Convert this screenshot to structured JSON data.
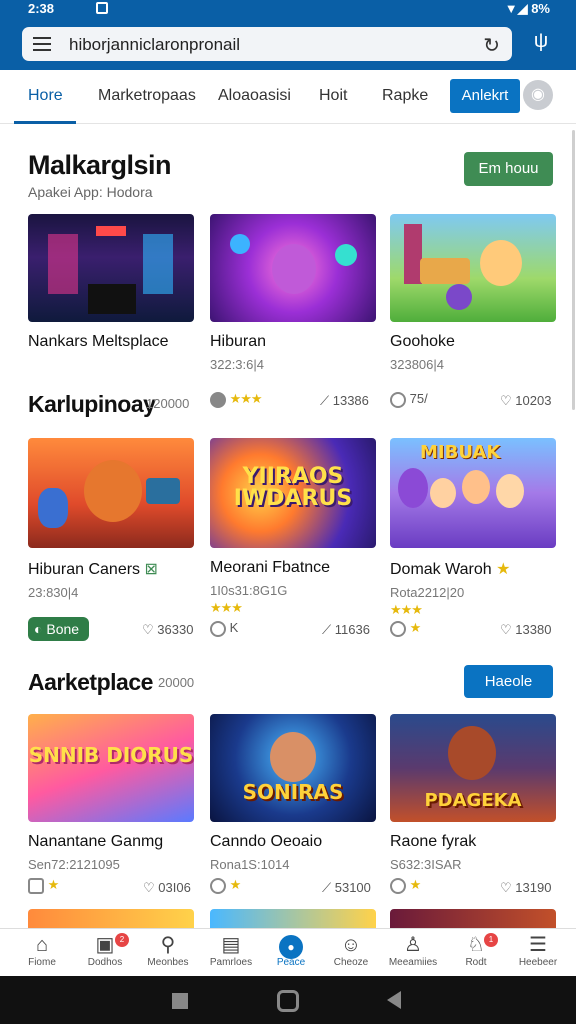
{
  "status": {
    "time": "2:38",
    "right": "8%"
  },
  "url": {
    "text": "hiborjanniclaronpronail"
  },
  "tabs": [
    {
      "label": "Hore"
    },
    {
      "label": "Marketropaas"
    },
    {
      "label": "Aloaoasisi"
    },
    {
      "label": "Hoit"
    },
    {
      "label": "Rapke"
    }
  ],
  "tab_button": "Anlekrt",
  "section1": {
    "title": "Malkarglsin",
    "subtitle": "Apakei App: Hodora",
    "button": "Em houu"
  },
  "section2": {
    "title": "Karlupinoay",
    "count": "120000"
  },
  "section3": {
    "title": "Aarketplace",
    "count": "20000",
    "button": "Haeole"
  },
  "row1": [
    {
      "title": "Nankars Meltsplace",
      "meta": "",
      "art": ""
    },
    {
      "title": "Hiburan",
      "meta": "322:3:6|4",
      "art": ""
    },
    {
      "title": "Goohoke",
      "meta": "323806|4",
      "art": ""
    }
  ],
  "row1_stats": [
    {
      "left": "",
      "right": ""
    },
    {
      "left": "★★★",
      "right": "13386"
    },
    {
      "left": "75/",
      "right": "10203"
    }
  ],
  "row2": [
    {
      "title": "Hiburan Caners",
      "meta": "23:830|4",
      "art": ""
    },
    {
      "title": "Meorani Fbatnce",
      "meta": "1I0s31:8G1G",
      "art": "YIIRAOS IWDARUS"
    },
    {
      "title": "Domak Waroh",
      "meta": "Rota2212|20",
      "art": "MIBUAK"
    }
  ],
  "row2_stats": [
    {
      "left": "Bone",
      "right": "36330"
    },
    {
      "left": "K",
      "right": "11636"
    },
    {
      "left": "",
      "right": "13380"
    }
  ],
  "row3": [
    {
      "title": "Nanantane Ganmg",
      "meta": "Sen72:2121095",
      "art": "SNNIB DIORUS"
    },
    {
      "title": "Canndo Oeoaio",
      "meta": "Rona1S:1014",
      "art": "SONIRAS"
    },
    {
      "title": "Raone fyrak",
      "meta": "S632:3ISAR",
      "art": "PDAGEKA"
    }
  ],
  "row3_stats": [
    {
      "left": "",
      "right": "03I06"
    },
    {
      "left": "",
      "right": "53100"
    },
    {
      "left": "",
      "right": "13190"
    }
  ],
  "nav": [
    {
      "label": "Fiome",
      "icon": "home-icon"
    },
    {
      "label": "Dodhos",
      "icon": "store-icon",
      "badge": "2"
    },
    {
      "label": "Meonbes",
      "icon": "search-icon"
    },
    {
      "label": "Pamrloes",
      "icon": "gallery-icon"
    },
    {
      "label": "Peace",
      "icon": "dot-icon"
    },
    {
      "label": "Cheoze",
      "icon": "chat-icon"
    },
    {
      "label": "Meeamiies",
      "icon": "person-icon"
    },
    {
      "label": "Rodt",
      "icon": "bell-icon",
      "badge": "1"
    },
    {
      "label": "Heebeer",
      "icon": "menu-icon"
    }
  ],
  "colors": {
    "primary": "#0a5fa6",
    "accent_blue": "#0a73c2",
    "green": "#3f8c54",
    "star": "#e6b90d"
  }
}
